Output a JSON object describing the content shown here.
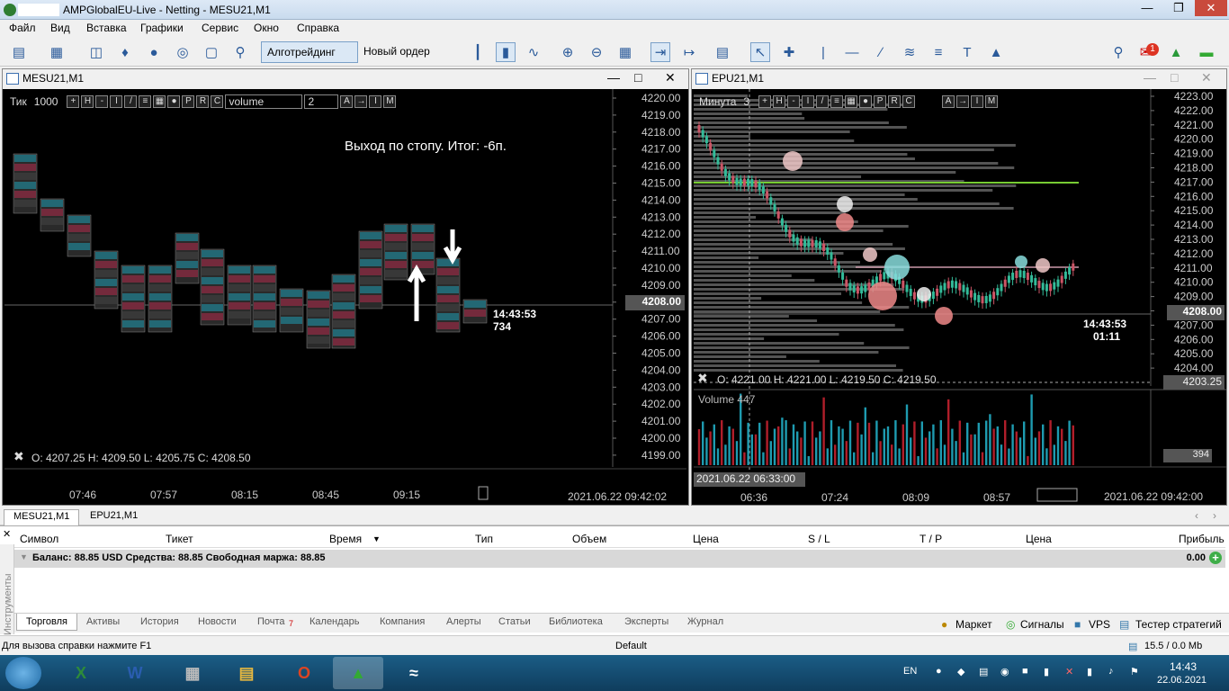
{
  "window": {
    "title": "AMPGlobalEU-Live - Netting - MESU21,M1"
  },
  "menu": [
    "Файл",
    "Вид",
    "Вставка",
    "Графики",
    "Сервис",
    "Окно",
    "Справка"
  ],
  "toolbar": {
    "algo_label": "Алготрейдинг",
    "order_label": "Новый ордер",
    "notification_count": "1",
    "lvl": "LVL"
  },
  "left_chart": {
    "tab_title": "MESU21,M1",
    "mode": "Тик",
    "tick_count": "1000",
    "indicator": "volume",
    "period_value": "2",
    "note": "Выход по стопу. Итог: -6п.",
    "ohlc": "O: 4207.25  H: 4209.50  L: 4205.75  C: 4208.50",
    "current_price": "4208.00",
    "last_time": "14:43:53",
    "last_vol": "734",
    "date_label": "2021.06.22 09:42:02",
    "price_ticks": [
      "4220.00",
      "4219.00",
      "4218.00",
      "4217.00",
      "4216.00",
      "4215.00",
      "4214.00",
      "4213.00",
      "4212.00",
      "4211.00",
      "4210.00",
      "4209.00",
      "4208.00",
      "4207.00",
      "4206.00",
      "4205.00",
      "4204.00",
      "4203.00",
      "4202.00",
      "4201.00",
      "4200.00",
      "4199.00"
    ],
    "time_ticks": [
      "07:46",
      "07:57",
      "08:15",
      "08:45",
      "09:15"
    ]
  },
  "right_chart": {
    "tab_title": "EPU21,M1",
    "mode": "Минута",
    "mode_num": "3",
    "ohlc": "O: 4221.00  H: 4221.00  L: 4219.50  C: 4219.50",
    "current_price": "4208.00",
    "cursor_price": "4203.25",
    "last_time": "14:43:53",
    "countdown": "01:11",
    "volume_title": "Volume 447",
    "volume_value": "394",
    "cursor_time": "2021.06.22 06:33:00",
    "date_label": "2021.06.22 09:42:00",
    "price_ticks": [
      "4223.00",
      "4222.00",
      "4221.00",
      "4220.00",
      "4219.00",
      "4218.00",
      "4217.00",
      "4216.00",
      "4215.00",
      "4214.00",
      "4213.00",
      "4212.00",
      "4211.00",
      "4210.00",
      "4209.00",
      "4208.00",
      "4207.00",
      "4206.00",
      "4205.00",
      "4204.00"
    ],
    "time_ticks": [
      "06:36",
      "07:24",
      "08:09",
      "08:57"
    ]
  },
  "chart_tabs": [
    "MESU21,M1",
    "EPU21,M1"
  ],
  "terminal": {
    "columns": [
      "Символ",
      "Тикет",
      "Время",
      "Тип",
      "Объем",
      "Цена",
      "S / L",
      "T / P",
      "Цена",
      "Прибыль"
    ],
    "balance_text": "Баланс: 88.85 USD  Средства: 88.85  Свободная маржа: 88.85",
    "profit": "0.00",
    "side_label": "Инструменты",
    "tabs": [
      "Торговля",
      "Активы",
      "История",
      "Новости",
      "Почта",
      "Календарь",
      "Компания",
      "Алерты",
      "Статьи",
      "Библиотека",
      "Эксперты",
      "Журнал"
    ],
    "mail_count": "7",
    "right_tabs": [
      "Маркет",
      "Сигналы",
      "VPS",
      "Тестер стратегий"
    ]
  },
  "status": {
    "help": "Для вызова справки нажмите F1",
    "profile": "Default",
    "traffic": "15.5 / 0.0 Mb"
  },
  "taskbar": {
    "lang": "EN",
    "time": "14:43",
    "date": "22.06.2021"
  }
}
